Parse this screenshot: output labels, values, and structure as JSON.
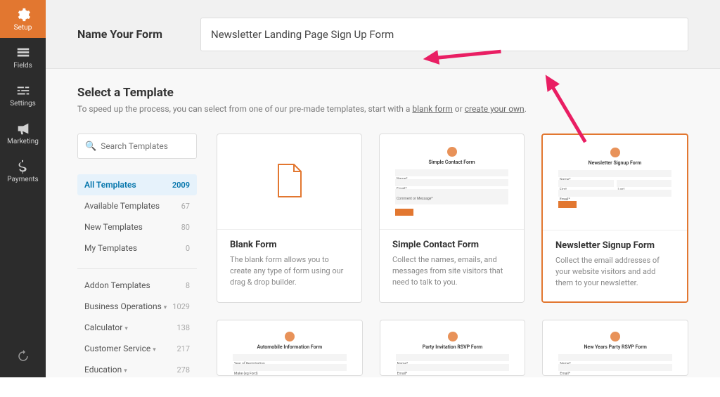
{
  "sidebar": {
    "items": [
      {
        "label": "Setup",
        "icon": "gear"
      },
      {
        "label": "Fields",
        "icon": "list"
      },
      {
        "label": "Settings",
        "icon": "sliders"
      },
      {
        "label": "Marketing",
        "icon": "bullhorn"
      },
      {
        "label": "Payments",
        "icon": "dollar"
      }
    ],
    "active_index": 0
  },
  "name_section": {
    "label": "Name Your Form",
    "value": "Newsletter Landing Page Sign Up Form"
  },
  "template_section": {
    "title": "Select a Template",
    "subtitle_prefix": "To speed up the process, you can select from one of our pre-made templates, start with a ",
    "link_blank": "blank form",
    "subtitle_middle": " or ",
    "link_create": "create your own",
    "subtitle_suffix": "."
  },
  "search": {
    "placeholder": "Search Templates"
  },
  "categories_main": [
    {
      "label": "All Templates",
      "count": "2009",
      "active": true
    },
    {
      "label": "Available Templates",
      "count": "67"
    },
    {
      "label": "New Templates",
      "count": "80"
    },
    {
      "label": "My Templates",
      "count": "0"
    }
  ],
  "categories_addon": [
    {
      "label": "Addon Templates",
      "count": "8"
    },
    {
      "label": "Business Operations",
      "count": "1029",
      "chevron": true
    },
    {
      "label": "Calculator",
      "count": "138",
      "chevron": true
    },
    {
      "label": "Customer Service",
      "count": "217",
      "chevron": true
    },
    {
      "label": "Education",
      "count": "278",
      "chevron": true
    }
  ],
  "cards_row1": [
    {
      "title": "Blank Form",
      "desc": "The blank form allows you to create any type of form using our drag & drop builder.",
      "preview": "blank"
    },
    {
      "title": "Simple Contact Form",
      "desc": "Collect the names, emails, and messages from site visitors that need to talk to you.",
      "preview": "contact",
      "preview_title": "Simple Contact Form"
    },
    {
      "title": "Newsletter Signup Form",
      "desc": "Collect the email addresses of your website visitors and add them to your newsletter.",
      "preview": "newsletter",
      "preview_title": "Newsletter Signup Form",
      "selected": true
    }
  ],
  "cards_row2": [
    {
      "preview_title": "Automobile Information Form"
    },
    {
      "preview_title": "Party Invitation RSVP Form"
    },
    {
      "preview_title": "New Years Party RSVP Form"
    }
  ]
}
